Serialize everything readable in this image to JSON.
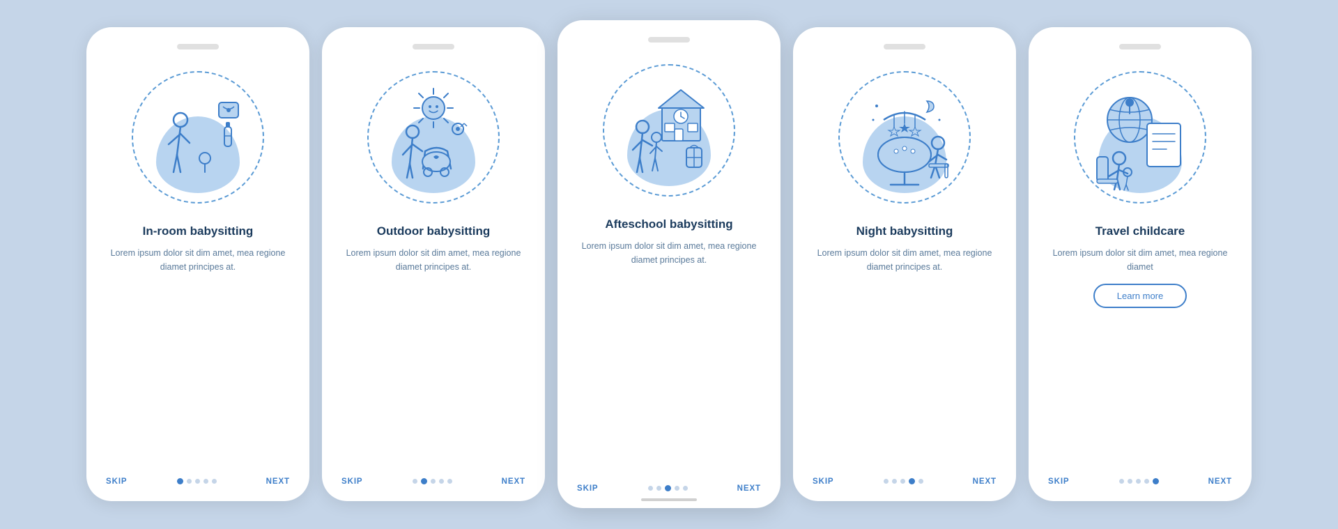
{
  "background_color": "#c5d5e8",
  "cards": [
    {
      "id": "card-1",
      "title": "In-room babysitting",
      "description": "Lorem ipsum dolor sit dim amet, mea regione diamet principes at.",
      "dots": [
        true,
        false,
        false,
        false,
        false
      ],
      "active_dot": 0,
      "show_learn_more": false,
      "is_active": false
    },
    {
      "id": "card-2",
      "title": "Outdoor babysitting",
      "description": "Lorem ipsum dolor sit dim amet, mea regione diamet principes at.",
      "dots": [
        false,
        true,
        false,
        false,
        false
      ],
      "active_dot": 1,
      "show_learn_more": false,
      "is_active": false
    },
    {
      "id": "card-3",
      "title": "Afteschool babysitting",
      "description": "Lorem ipsum dolor sit dim amet, mea regione diamet principes at.",
      "dots": [
        false,
        false,
        true,
        false,
        false
      ],
      "active_dot": 2,
      "show_learn_more": false,
      "is_active": true
    },
    {
      "id": "card-4",
      "title": "Night babysitting",
      "description": "Lorem ipsum dolor sit dim amet, mea regione diamet principes at.",
      "dots": [
        false,
        false,
        false,
        true,
        false
      ],
      "active_dot": 3,
      "show_learn_more": false,
      "is_active": false
    },
    {
      "id": "card-5",
      "title": "Travel childcare",
      "description": "Lorem ipsum dolor sit dim amet, mea regione diamet",
      "dots": [
        false,
        false,
        false,
        false,
        true
      ],
      "active_dot": 4,
      "show_learn_more": true,
      "is_active": false
    }
  ],
  "labels": {
    "skip": "SKIP",
    "next": "NEXT",
    "learn_more": "Learn more"
  }
}
